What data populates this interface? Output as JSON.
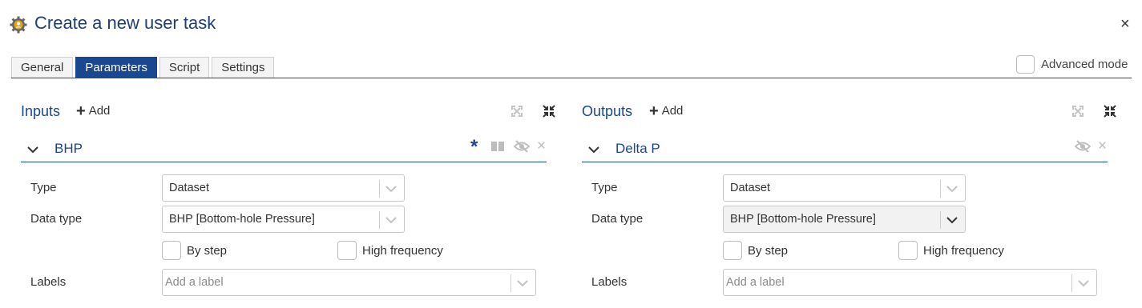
{
  "dialog": {
    "title": "Create a new user task",
    "close": "×",
    "icon": "gear-user-icon"
  },
  "tabs": [
    {
      "label": "General",
      "active": false
    },
    {
      "label": "Parameters",
      "active": true
    },
    {
      "label": "Script",
      "active": false
    },
    {
      "label": "Settings",
      "active": false
    }
  ],
  "advanced_mode": {
    "label": "Advanced mode",
    "checked": false
  },
  "inputs": {
    "title": "Inputs",
    "add_label": "Add",
    "param": {
      "name": "BHP",
      "required_marker": "*",
      "remove": "×",
      "type_label": "Type",
      "type_value": "Dataset",
      "datatype_label": "Data type",
      "datatype_value": "BHP [Bottom-hole Pressure]",
      "by_step_label": "By step",
      "high_freq_label": "High frequency",
      "labels_label": "Labels",
      "labels_placeholder": "Add a label"
    }
  },
  "outputs": {
    "title": "Outputs",
    "add_label": "Add",
    "param": {
      "name": "Delta P",
      "remove": "×",
      "type_label": "Type",
      "type_value": "Dataset",
      "datatype_label": "Data type",
      "datatype_value": "BHP [Bottom-hole Pressure]",
      "by_step_label": "By step",
      "high_freq_label": "High frequency",
      "labels_label": "Labels",
      "labels_placeholder": "Add a label"
    }
  },
  "colors": {
    "accent": "#1b4690",
    "title": "#1f3d7a",
    "icon_gold": "#e8a317"
  }
}
